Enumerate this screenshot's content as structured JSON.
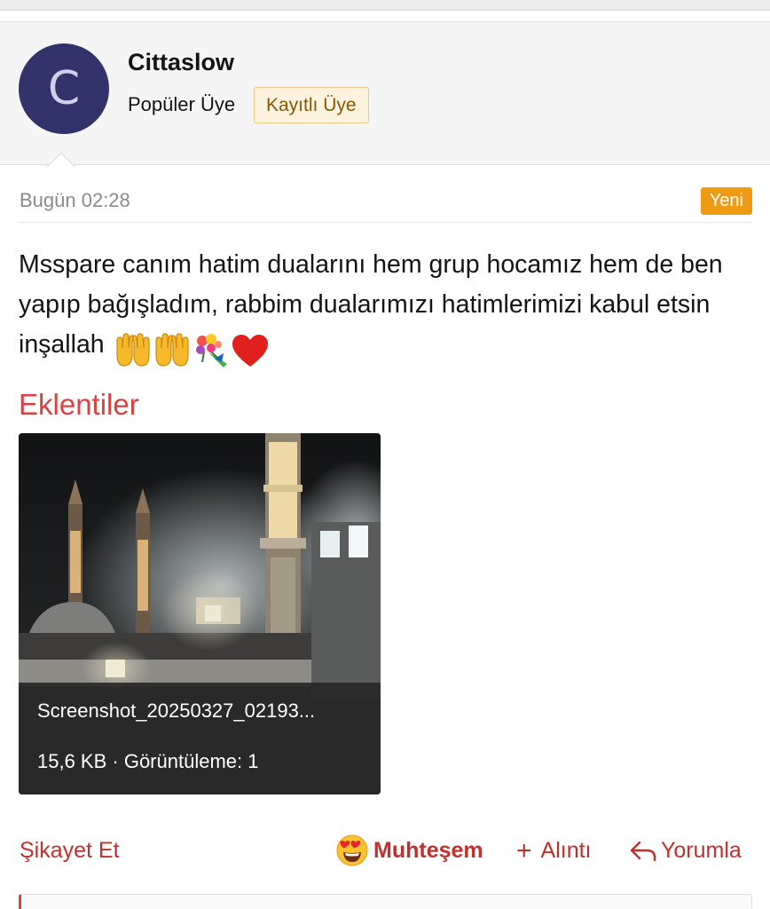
{
  "user": {
    "avatar_letter": "C",
    "avatar_color": "#33336b",
    "name": "Cittaslow",
    "title": "Popüler Üye",
    "badge": "Kayıtlı Üye"
  },
  "post": {
    "timestamp": "Bugün 02:28",
    "new_badge": "Yeni",
    "message": "Msspare canım hatim dualarını hem grup hocamız hem de ben yapıp bağışladım, rabbim dualarımızı hatimlerimizi kabul etsin inşallah",
    "emojis": [
      "raised-hands-emoji",
      "raised-hands-emoji",
      "bouquet-emoji",
      "red-heart-emoji"
    ]
  },
  "attachments": {
    "title": "Eklentiler",
    "items": [
      {
        "filename": "Screenshot_20250327_02193...",
        "info": "15,6 KB · Görüntüleme: 1"
      }
    ]
  },
  "actions": {
    "report": "Şikayet Et",
    "reaction": "Muhteşem",
    "reaction_icon": "heart-eyes-emoji",
    "quote": "Alıntı",
    "reply": "Yorumla"
  },
  "colors": {
    "accent_red": "#d9423f",
    "link_red": "#c0302e",
    "new_badge": "#ef9a13",
    "badge_bg": "#fdf3df"
  }
}
